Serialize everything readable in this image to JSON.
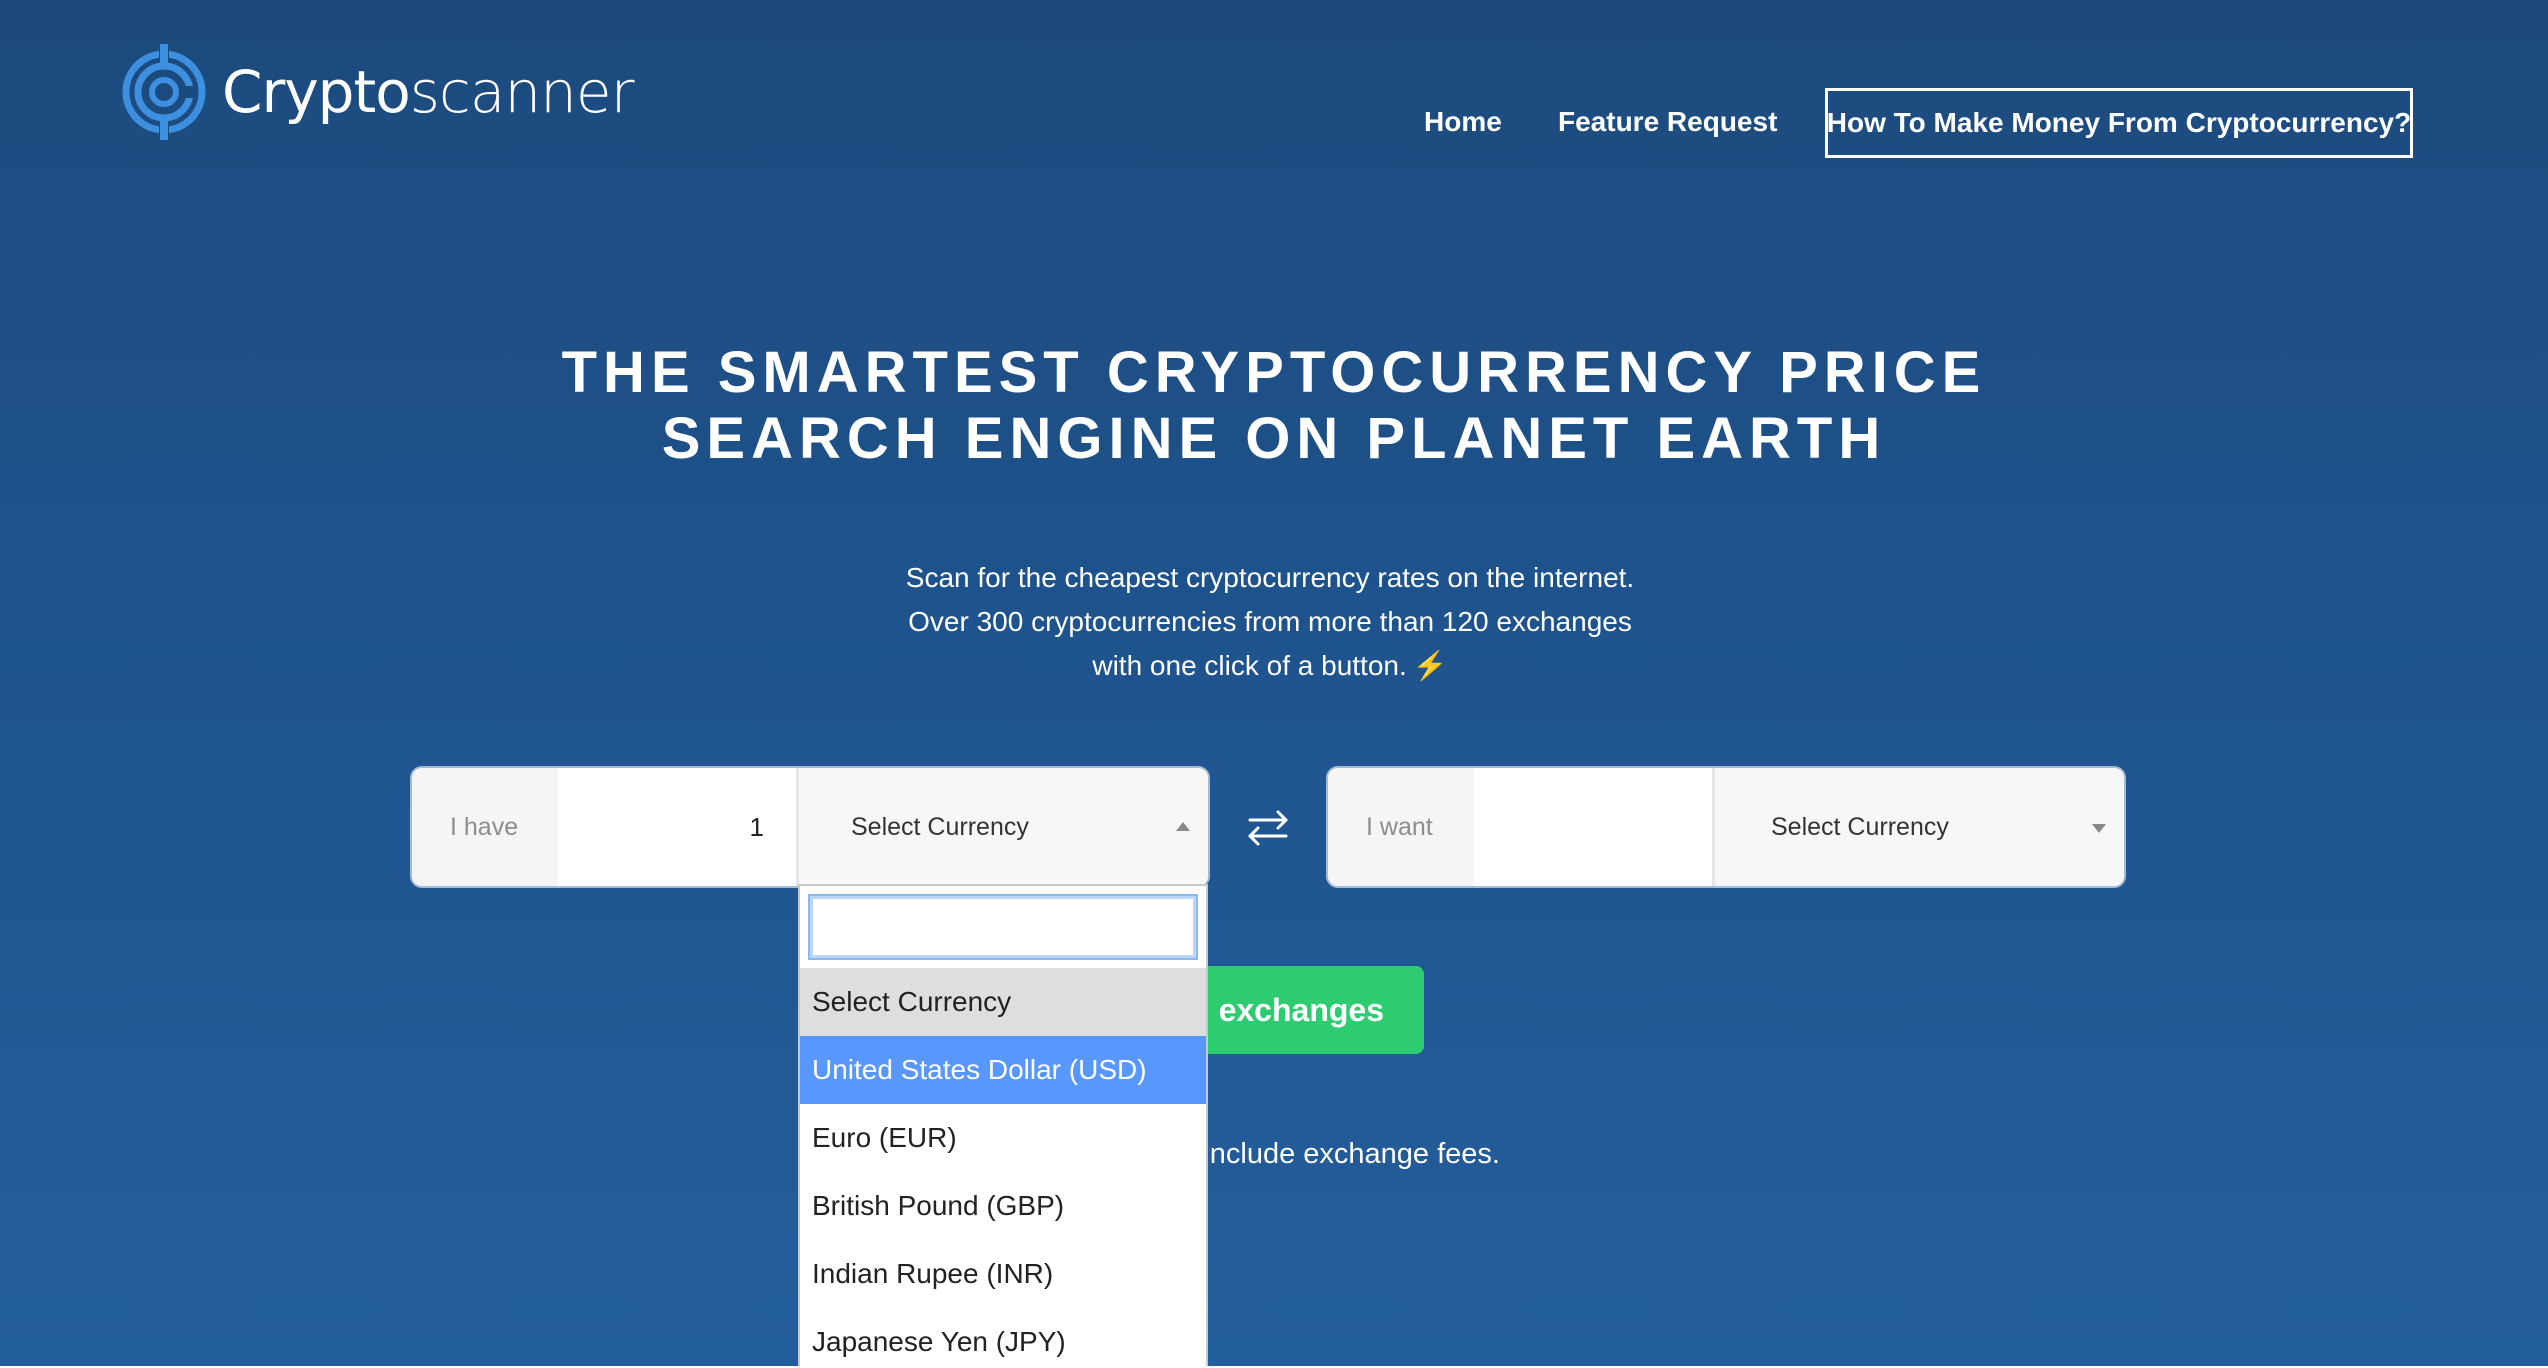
{
  "header": {
    "logo_text_bold": "Crypto",
    "logo_text_light": "scanner",
    "nav": {
      "home": "Home",
      "feature_request": "Feature Request",
      "cta": "How To Make Money From Cryptocurrency?"
    }
  },
  "hero": {
    "title_line1": "THE SMARTEST CRYPTOCURRENCY PRICE",
    "title_line2": "SEARCH ENGINE ON PLANET EARTH",
    "subtitle": "Scan for the cheapest cryptocurrency rates on the internet. Over 300 cryptocurrencies from more than 120 exchanges with one click of a button.",
    "bolt": "⚡"
  },
  "converter": {
    "have_label": "I have",
    "have_amount": "1",
    "have_currency": "Select Currency",
    "want_label": "I want",
    "want_amount": "",
    "want_currency": "Select Currency"
  },
  "scan_button_visible_text": "n exchanges",
  "fees_note_visible_text": "t include exchange fees.",
  "dropdown": {
    "search_value": "",
    "options": [
      "Select Currency",
      "United States Dollar (USD)",
      "Euro (EUR)",
      "British Pound (GBP)",
      "Indian Rupee (INR)",
      "Japanese Yen (JPY)"
    ],
    "highlighted_index": 1
  },
  "colors": {
    "background_top": "#1c4a7d",
    "background_bottom": "#235e9c",
    "accent_green": "#2ecc71",
    "highlight_blue": "#5897fb",
    "logo_blue": "#3d8fe0"
  }
}
